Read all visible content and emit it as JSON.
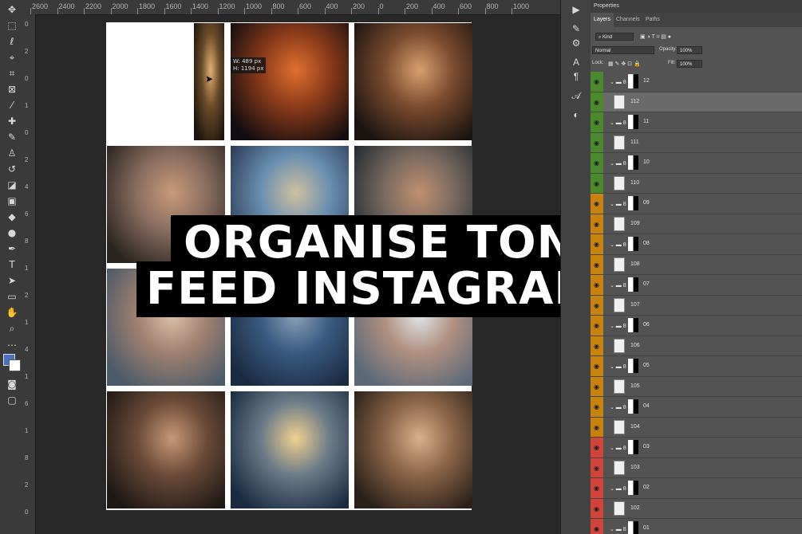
{
  "title": {
    "line1": "ORGANISE TON",
    "line2": "FEED INSTAGRAM"
  },
  "ruler_top": [
    "2600",
    "2400",
    "2200",
    "2000",
    "1800",
    "1600",
    "1400",
    "1200",
    "1000",
    "800",
    "600",
    "400",
    "200",
    "0",
    "200",
    "400",
    "600",
    "800",
    "1000"
  ],
  "ruler_left": [
    "0",
    "2",
    "0",
    "1",
    "0",
    "2",
    "4",
    "6",
    "8",
    "1",
    "2",
    "1",
    "4",
    "1",
    "6",
    "1",
    "8",
    "2",
    "0"
  ],
  "tooltip": {
    "width": "W: 489 px",
    "height": "H: 1194 px"
  },
  "panel": {
    "header": "Properties",
    "tabs": [
      "Layers",
      "Channels",
      "Paths"
    ],
    "kind_label": "Kind",
    "blend_mode": "Normal",
    "opacity_label": "Opacity:",
    "opacity_value": "100%",
    "lock_label": "Lock:",
    "fill_label": "Fill:",
    "fill_value": "100%"
  },
  "layers": [
    {
      "name": "12",
      "kind": "group",
      "color": "#4a8a2c",
      "selected": false
    },
    {
      "name": "112",
      "kind": "layer",
      "color": "#4a8a2c",
      "selected": true
    },
    {
      "name": "11",
      "kind": "group",
      "color": "#4a8a2c",
      "selected": false
    },
    {
      "name": "111",
      "kind": "layer",
      "color": "#4a8a2c",
      "selected": false
    },
    {
      "name": "10",
      "kind": "group",
      "color": "#4a8a2c",
      "selected": false
    },
    {
      "name": "110",
      "kind": "layer",
      "color": "#4a8a2c",
      "selected": false
    },
    {
      "name": "09",
      "kind": "group",
      "color": "#c8820e",
      "selected": false
    },
    {
      "name": "109",
      "kind": "layer",
      "color": "#c8820e",
      "selected": false
    },
    {
      "name": "08",
      "kind": "group",
      "color": "#c8820e",
      "selected": false
    },
    {
      "name": "108",
      "kind": "layer",
      "color": "#c8820e",
      "selected": false
    },
    {
      "name": "07",
      "kind": "group",
      "color": "#c8820e",
      "selected": false
    },
    {
      "name": "107",
      "kind": "layer",
      "color": "#c8820e",
      "selected": false
    },
    {
      "name": "06",
      "kind": "group",
      "color": "#c8820e",
      "selected": false
    },
    {
      "name": "106",
      "kind": "layer",
      "color": "#c8820e",
      "selected": false
    },
    {
      "name": "05",
      "kind": "group",
      "color": "#c8820e",
      "selected": false
    },
    {
      "name": "105",
      "kind": "layer",
      "color": "#c8820e",
      "selected": false
    },
    {
      "name": "04",
      "kind": "group",
      "color": "#c8820e",
      "selected": false
    },
    {
      "name": "104",
      "kind": "layer",
      "color": "#c8820e",
      "selected": false
    },
    {
      "name": "03",
      "kind": "group",
      "color": "#d0443a",
      "selected": false
    },
    {
      "name": "103",
      "kind": "layer",
      "color": "#d0443a",
      "selected": false
    },
    {
      "name": "02",
      "kind": "group",
      "color": "#d0443a",
      "selected": false
    },
    {
      "name": "102",
      "kind": "layer",
      "color": "#d0443a",
      "selected": false
    },
    {
      "name": "01",
      "kind": "group",
      "color": "#d0443a",
      "selected": false
    }
  ],
  "photos": [
    {
      "name": "photo-bokeh-partial",
      "colors": [
        "#1b140e",
        "#6a4a28",
        "#e0b070"
      ]
    },
    {
      "name": "photo-night-street",
      "colors": [
        "#120d10",
        "#8a3a1a",
        "#e07030"
      ]
    },
    {
      "name": "photo-woman-lights",
      "colors": [
        "#1a1410",
        "#7a4a2e",
        "#d8a070"
      ]
    },
    {
      "name": "photo-redhead-bed",
      "colors": [
        "#2a2420",
        "#8a6e60",
        "#c99a7a"
      ]
    },
    {
      "name": "photo-sea-sunset",
      "colors": [
        "#2a3a55",
        "#6a8fb0",
        "#d0c0a0"
      ]
    },
    {
      "name": "photo-two-women",
      "colors": [
        "#202a30",
        "#7a6a60",
        "#c09070"
      ]
    },
    {
      "name": "photo-woman-lying",
      "colors": [
        "#4a5a68",
        "#a08070",
        "#dcc0a8"
      ]
    },
    {
      "name": "photo-blue-sea",
      "colors": [
        "#1a2a40",
        "#3a5a80",
        "#8aa0b8"
      ]
    },
    {
      "name": "photo-woman-pillow",
      "colors": [
        "#5a6878",
        "#b09080",
        "#e0e4ea"
      ]
    },
    {
      "name": "photo-woman-portrait",
      "colors": [
        "#1e1814",
        "#6a4a38",
        "#c89878"
      ]
    },
    {
      "name": "photo-silhouette",
      "colors": [
        "#1a2a40",
        "#6a7a88",
        "#f0d090"
      ]
    },
    {
      "name": "photo-woman-hair",
      "colors": [
        "#2a2018",
        "#8a6448",
        "#d8b08a"
      ]
    }
  ]
}
